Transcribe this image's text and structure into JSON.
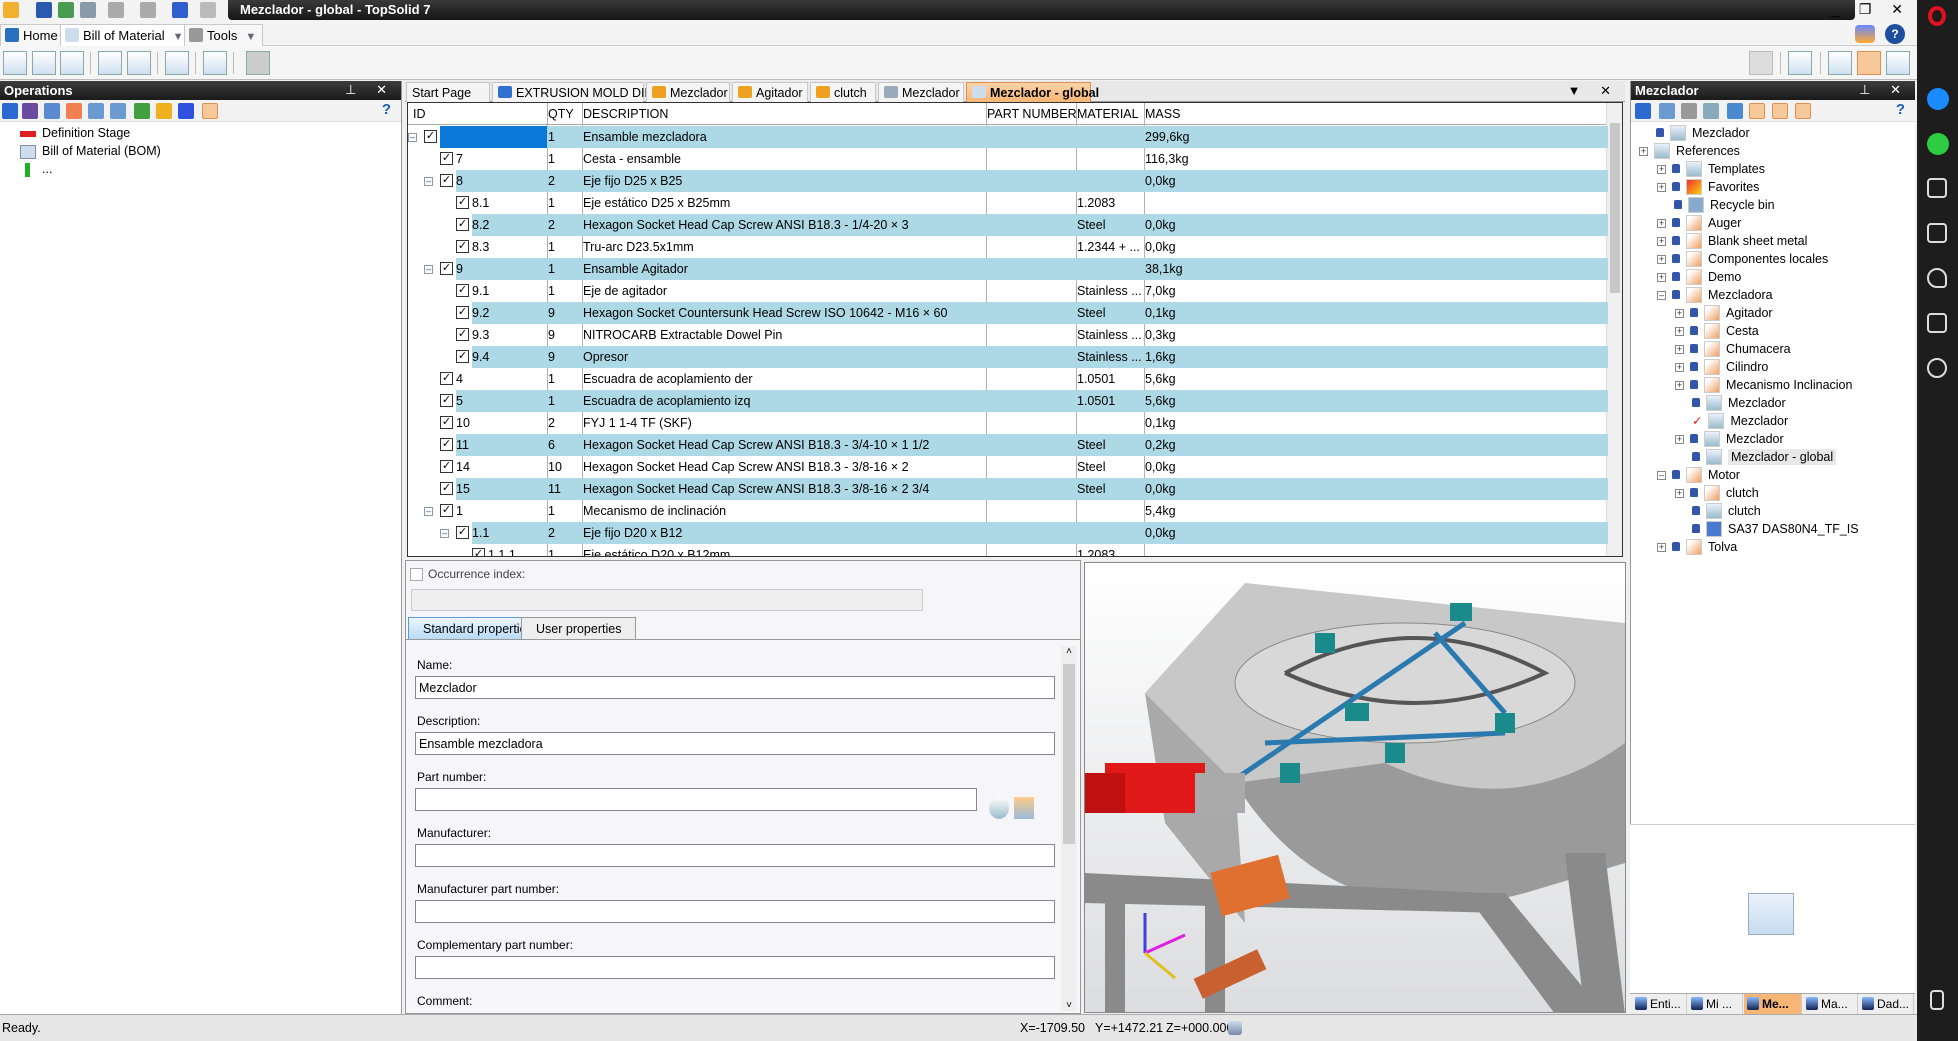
{
  "window": {
    "title": "Mezclador - global - TopSolid 7",
    "controls": "_ ❐ ✕"
  },
  "ribbon": {
    "tabs": [
      {
        "label": "Home"
      },
      {
        "label": "Bill of Material"
      },
      {
        "label": "Tools"
      }
    ]
  },
  "operations": {
    "title": "Operations",
    "help": "?",
    "items": [
      {
        "label": "Definition Stage",
        "icon": "red-arrow-icon"
      },
      {
        "label": "Bill of Material (BOM)",
        "icon": "bom-icon"
      },
      {
        "label": "...",
        "icon": "green-arrow-up-icon"
      }
    ]
  },
  "doc_tabs": [
    {
      "label": "Start Page"
    },
    {
      "label": "EXTRUSION MOLD DIE"
    },
    {
      "label": "Mezclador"
    },
    {
      "label": "Agitador"
    },
    {
      "label": "clutch"
    },
    {
      "label": "Mezclador"
    },
    {
      "label": "Mezclador - global",
      "active": true
    }
  ],
  "bom": {
    "columns": [
      "ID",
      "QTY",
      "DESCRIPTION",
      "PART NUMBER",
      "MATERIAL",
      "MASS"
    ],
    "rows": [
      {
        "level": 0,
        "id": "",
        "qty": "1",
        "desc": "Ensamble mezcladora",
        "pn": "",
        "mat": "",
        "mass": "299,6kg",
        "expand": true,
        "selected": true
      },
      {
        "level": 1,
        "id": "7",
        "qty": "1",
        "desc": "Cesta - ensamble",
        "pn": "",
        "mat": "",
        "mass": "116,3kg"
      },
      {
        "level": 1,
        "id": "8",
        "qty": "2",
        "desc": "Eje fijo D25 x B25",
        "pn": "",
        "mat": "",
        "mass": "0,0kg",
        "expand": true
      },
      {
        "level": 2,
        "id": "8.1",
        "qty": "1",
        "desc": "Eje estático D25 x B25mm",
        "pn": "",
        "mat": "1.2083",
        "mass": ""
      },
      {
        "level": 2,
        "id": "8.2",
        "qty": "2",
        "desc": "Hexagon Socket Head Cap Screw ANSI B18.3 - 1/4-20 × 3",
        "pn": "",
        "mat": "Steel",
        "mass": "0,0kg"
      },
      {
        "level": 2,
        "id": "8.3",
        "qty": "1",
        "desc": "Tru-arc D23.5x1mm",
        "pn": "",
        "mat": "1.2344 + ...",
        "mass": "0,0kg"
      },
      {
        "level": 1,
        "id": "9",
        "qty": "1",
        "desc": "Ensamble Agitador",
        "pn": "",
        "mat": "",
        "mass": "38,1kg",
        "expand": true
      },
      {
        "level": 2,
        "id": "9.1",
        "qty": "1",
        "desc": "Eje de agitador",
        "pn": "",
        "mat": "Stainless ...",
        "mass": "7,0kg"
      },
      {
        "level": 2,
        "id": "9.2",
        "qty": "9",
        "desc": "Hexagon Socket Countersunk Head Screw ISO 10642 - M16 × 60",
        "pn": "",
        "mat": "Steel",
        "mass": "0,1kg"
      },
      {
        "level": 2,
        "id": "9.3",
        "qty": "9",
        "desc": "NITROCARB Extractable Dowel Pin",
        "pn": "",
        "mat": "Stainless ...",
        "mass": "0,3kg"
      },
      {
        "level": 2,
        "id": "9.4",
        "qty": "9",
        "desc": "Opresor",
        "pn": "",
        "mat": "Stainless ...",
        "mass": "1,6kg"
      },
      {
        "level": 1,
        "id": "4",
        "qty": "1",
        "desc": "Escuadra de acoplamiento der",
        "pn": "",
        "mat": "1.0501",
        "mass": "5,6kg"
      },
      {
        "level": 1,
        "id": "5",
        "qty": "1",
        "desc": "Escuadra de acoplamiento izq",
        "pn": "",
        "mat": "1.0501",
        "mass": "5,6kg"
      },
      {
        "level": 1,
        "id": "10",
        "qty": "2",
        "desc": "FYJ 1 1-4 TF (SKF)",
        "pn": "",
        "mat": "",
        "mass": "0,1kg"
      },
      {
        "level": 1,
        "id": "11",
        "qty": "6",
        "desc": "Hexagon Socket Head Cap Screw ANSI B18.3 - 3/4-10 × 1 1/2",
        "pn": "",
        "mat": "Steel",
        "mass": "0,2kg"
      },
      {
        "level": 1,
        "id": "14",
        "qty": "10",
        "desc": "Hexagon Socket Head Cap Screw ANSI B18.3 - 3/8-16 × 2",
        "pn": "",
        "mat": "Steel",
        "mass": "0,0kg"
      },
      {
        "level": 1,
        "id": "15",
        "qty": "11",
        "desc": "Hexagon Socket Head Cap Screw ANSI B18.3 - 3/8-16 × 2 3/4",
        "pn": "",
        "mat": "Steel",
        "mass": "0,0kg"
      },
      {
        "level": 1,
        "id": "1",
        "qty": "1",
        "desc": "Mecanismo de inclinación",
        "pn": "",
        "mat": "",
        "mass": "5,4kg",
        "expand": true
      },
      {
        "level": 2,
        "id": "1.1",
        "qty": "2",
        "desc": "Eje fijo D20 x B12",
        "pn": "",
        "mat": "",
        "mass": "0,0kg",
        "expand": true
      },
      {
        "level": 3,
        "id": "1.1.1",
        "qty": "1",
        "desc": "Eje estático D20 x B12mm",
        "pn": "",
        "mat": "1.2083",
        "mass": ""
      }
    ]
  },
  "properties": {
    "occurrence_label": "Occurrence index:",
    "tabs": [
      "Standard properties",
      "User properties"
    ],
    "fields": [
      {
        "label": "Name:",
        "value": "Mezclador"
      },
      {
        "label": "Description:",
        "value": "Ensamble mezcladora"
      },
      {
        "label": "Part number:",
        "value": ""
      },
      {
        "label": "Manufacturer:",
        "value": ""
      },
      {
        "label": "Manufacturer part number:",
        "value": ""
      },
      {
        "label": "Complementary part number:",
        "value": ""
      },
      {
        "label": "Comment:",
        "value": ""
      }
    ]
  },
  "library": {
    "title": "Mezclador",
    "help": "?",
    "items": [
      {
        "level": 0,
        "label": "Mezclador",
        "icon": "project-icon"
      },
      {
        "level": 0,
        "label": "References",
        "icon": "references-icon",
        "expand": "+"
      },
      {
        "level": 1,
        "label": "Templates",
        "icon": "templates-folder-icon",
        "expand": "+"
      },
      {
        "level": 1,
        "label": "Favorites",
        "icon": "favorites-folder-icon",
        "expand": "+"
      },
      {
        "level": 1,
        "label": "Recycle bin",
        "icon": "recycle-bin-icon"
      },
      {
        "level": 1,
        "label": "Auger",
        "icon": "folder-icon",
        "expand": "+"
      },
      {
        "level": 1,
        "label": "Blank sheet metal",
        "icon": "folder-icon",
        "expand": "+"
      },
      {
        "level": 1,
        "label": "Componentes locales",
        "icon": "folder-icon",
        "expand": "+"
      },
      {
        "level": 1,
        "label": "Demo",
        "icon": "folder-icon",
        "expand": "+"
      },
      {
        "level": 1,
        "label": "Mezcladora",
        "icon": "folder-icon",
        "expand": "-"
      },
      {
        "level": 2,
        "label": "Agitador",
        "icon": "folder-icon",
        "expand": "+"
      },
      {
        "level": 2,
        "label": "Cesta",
        "icon": "folder-icon",
        "expand": "+"
      },
      {
        "level": 2,
        "label": "Chumacera",
        "icon": "folder-icon",
        "expand": "+"
      },
      {
        "level": 2,
        "label": "Cilindro",
        "icon": "folder-icon",
        "expand": "+"
      },
      {
        "level": 2,
        "label": "Mecanismo Inclinacion",
        "icon": "folder-icon",
        "expand": "+"
      },
      {
        "level": 2,
        "label": "Mezclador",
        "icon": "bom-doc-icon"
      },
      {
        "level": 2,
        "label": "Mezclador",
        "icon": "drawing-doc-icon",
        "check": true
      },
      {
        "level": 2,
        "label": "Mezclador",
        "icon": "assembly-doc-icon",
        "expand": "+"
      },
      {
        "level": 2,
        "label": "Mezclador - global",
        "icon": "bom-doc-icon",
        "highlight": true
      },
      {
        "level": 1,
        "label": "Motor",
        "icon": "folder-icon",
        "expand": "-"
      },
      {
        "level": 2,
        "label": "clutch",
        "icon": "folder-icon",
        "expand": "+"
      },
      {
        "level": 2,
        "label": "clutch",
        "icon": "assembly-doc-icon"
      },
      {
        "level": 2,
        "label": "SA37 DAS80N4_TF_IS",
        "icon": "part-icon"
      },
      {
        "level": 1,
        "label": "Tolva",
        "icon": "folder-icon",
        "expand": "+"
      }
    ],
    "bottom_tabs": [
      {
        "label": "Enti..."
      },
      {
        "label": "Mi ..."
      },
      {
        "label": "Me...",
        "active": true
      },
      {
        "label": "Ma..."
      },
      {
        "label": "Dad..."
      }
    ]
  },
  "status": {
    "text": "Ready.",
    "x": "X=-1709.50",
    "y": "Y=+1472.21",
    "z": "Z=+000.000"
  },
  "colors": {
    "row_highlight": "#add8e6",
    "selection": "#0a78d7",
    "active_tab": "#f7b675"
  }
}
